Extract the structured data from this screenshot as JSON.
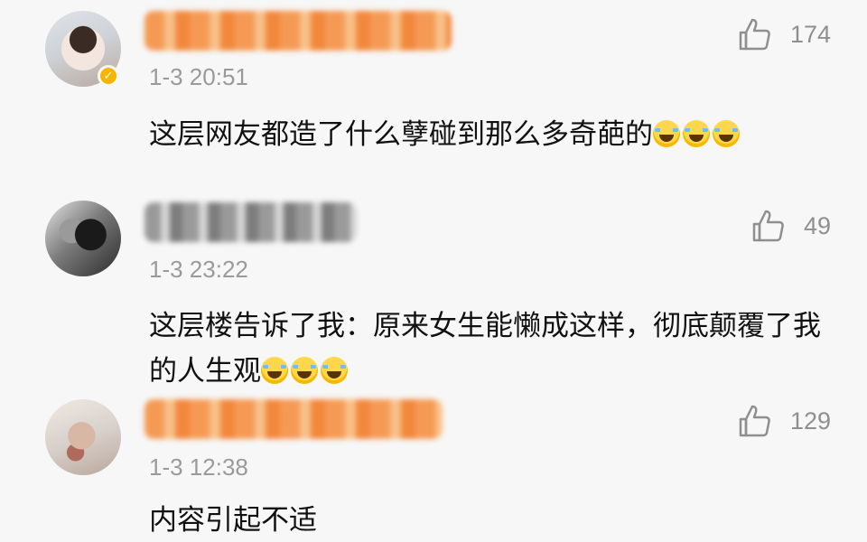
{
  "comments": [
    {
      "time": "1-3 20:51",
      "likes": "174",
      "text": "这层网友都造了什么孽碰到那么多奇葩的",
      "verified": true,
      "emoji_name": "laughing-crying-emoji",
      "emoji_count": 3
    },
    {
      "time": "1-3 23:22",
      "likes": "49",
      "text": "这层楼告诉了我：原来女生能懒成这样，彻底颠覆了我的人生观",
      "emoji_name": "laughing-crying-emoji",
      "emoji_count": 3
    },
    {
      "time": "1-3 12:38",
      "likes": "129",
      "text": "内容引起不适",
      "emoji_count": 0
    }
  ],
  "colors": {
    "background": "#f7f7f7",
    "body_text": "#111111",
    "meta_text": "#9a9a9a",
    "verified_badge": "#f7b500",
    "name_blur_orange": "#f59a55",
    "name_blur_gray": "#9a9a9a"
  },
  "icons": {
    "like": "thumbs-up-icon",
    "verified": "verified-badge-icon",
    "emoji": "laughing-crying-emoji"
  }
}
